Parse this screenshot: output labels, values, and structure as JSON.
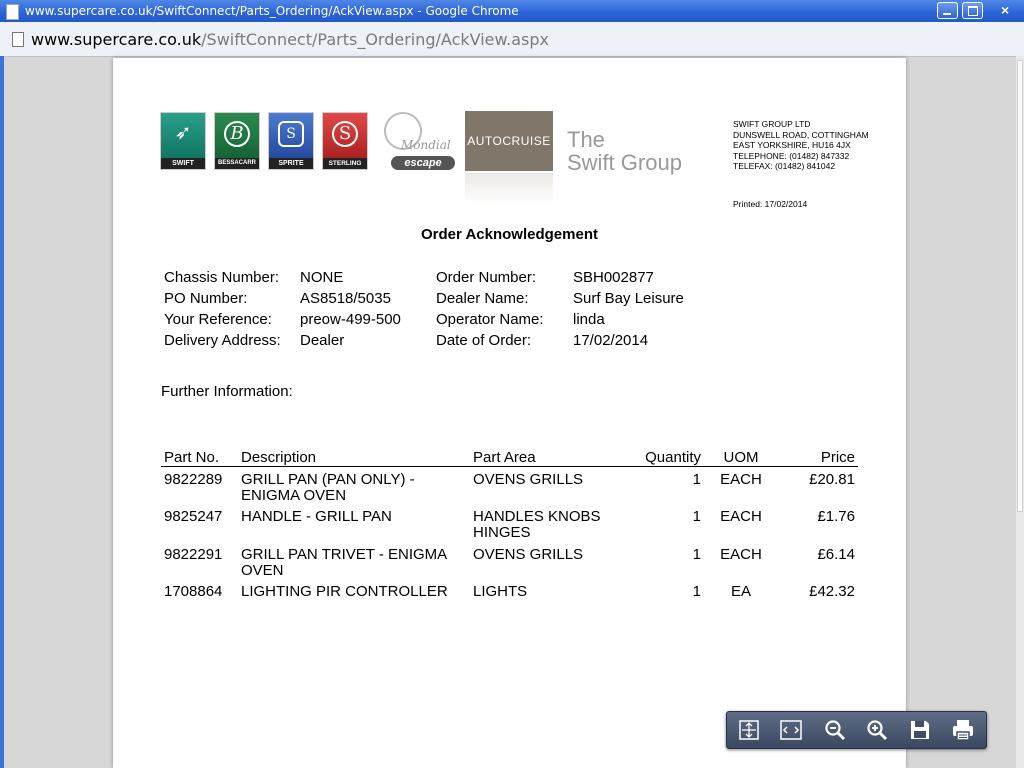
{
  "window": {
    "title": "www.supercare.co.uk/SwiftConnect/Parts_Ordering/AckView.aspx - Google Chrome",
    "close_glyph": "×"
  },
  "address": {
    "host": "www.supercare.co.uk",
    "path": "/SwiftConnect/Parts_Ordering/AckView.aspx"
  },
  "logos": {
    "swift": "SWIFT",
    "bessacarr": "BESSACARR",
    "sprite": "SPRITE",
    "sterling": "STERLING",
    "mondial": "Mondial",
    "escape": "escape",
    "autocruise": "AUTOCRUISE",
    "swift_group_line1": "The",
    "swift_group_line2": "Swift Group"
  },
  "company": {
    "name": "SWIFT GROUP LTD",
    "address1": "DUNSWELL ROAD, COTTINGHAM",
    "address2": "EAST YORKSHIRE, HU16 4JX",
    "telephone": "TELEPHONE: (01482) 847332",
    "telefax": "TELEFAX: (01482) 841042"
  },
  "printed": "Printed: 17/02/2014",
  "heading": "Order Acknowledgement",
  "details": {
    "chassis_label": "Chassis Number:",
    "chassis_value": "NONE",
    "po_label": "PO Number:",
    "po_value": "AS8518/5035",
    "ref_label": "Your Reference:",
    "ref_value": "preow-499-500",
    "delivery_label": "Delivery Address:",
    "delivery_value": "Dealer",
    "order_label": "Order Number:",
    "order_value": "SBH002877",
    "dealer_label": "Dealer Name:",
    "dealer_value": "Surf Bay Leisure",
    "operator_label": "Operator Name:",
    "operator_value": "linda",
    "date_label": "Date of Order:",
    "date_value": "17/02/2014"
  },
  "further_information": "Further Information:",
  "table": {
    "headers": {
      "part_no": "Part No.",
      "description": "Description",
      "part_area": "Part Area",
      "quantity": "Quantity",
      "uom": "UOM",
      "price": "Price"
    },
    "rows": [
      {
        "part_no": "9822289",
        "description": "GRILL PAN (PAN ONLY) - ENIGMA OVEN",
        "part_area": "OVENS GRILLS",
        "quantity": "1",
        "uom": "EACH",
        "price": "£20.81"
      },
      {
        "part_no": "9825247",
        "description": "HANDLE - GRILL PAN",
        "part_area": "HANDLES KNOBS HINGES",
        "quantity": "1",
        "uom": "EACH",
        "price": "£1.76"
      },
      {
        "part_no": "9822291",
        "description": "GRILL PAN TRIVET - ENIGMA OVEN",
        "part_area": "OVENS GRILLS",
        "quantity": "1",
        "uom": "EACH",
        "price": "£6.14"
      },
      {
        "part_no": "1708864",
        "description": "LIGHTING PIR CONTROLLER",
        "part_area": "LIGHTS",
        "quantity": "1",
        "uom": "EA",
        "price": "£42.32"
      }
    ]
  },
  "toolbar_icons": [
    "fit-page-icon",
    "fit-width-icon",
    "zoom-out-icon",
    "zoom-in-icon",
    "save-icon",
    "print-icon"
  ]
}
